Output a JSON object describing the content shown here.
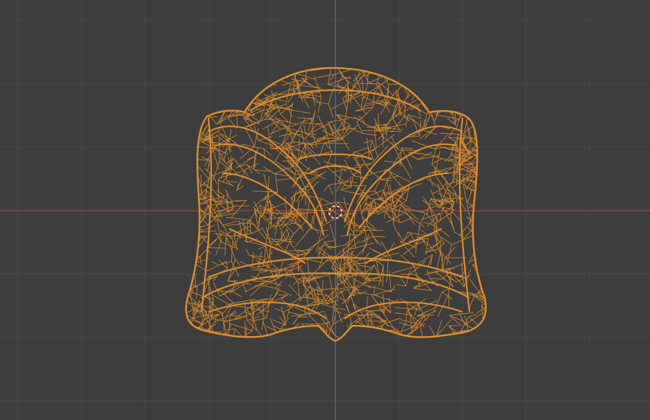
{
  "viewport": {
    "mode": "wireframe",
    "view": "front-orthographic",
    "background_color": "#3d3d3d",
    "grid_color": "#484848",
    "x_axis_color": "#a9444c",
    "z_axis_color": "#4a77b4",
    "selection_color": "#e58e26",
    "cursor_colors": [
      "#e83a3a",
      "#f0f0f0"
    ]
  },
  "object": {
    "selected": true,
    "shape": "skull-like mesh"
  },
  "icons": {
    "cursor": "3d-cursor-icon"
  }
}
